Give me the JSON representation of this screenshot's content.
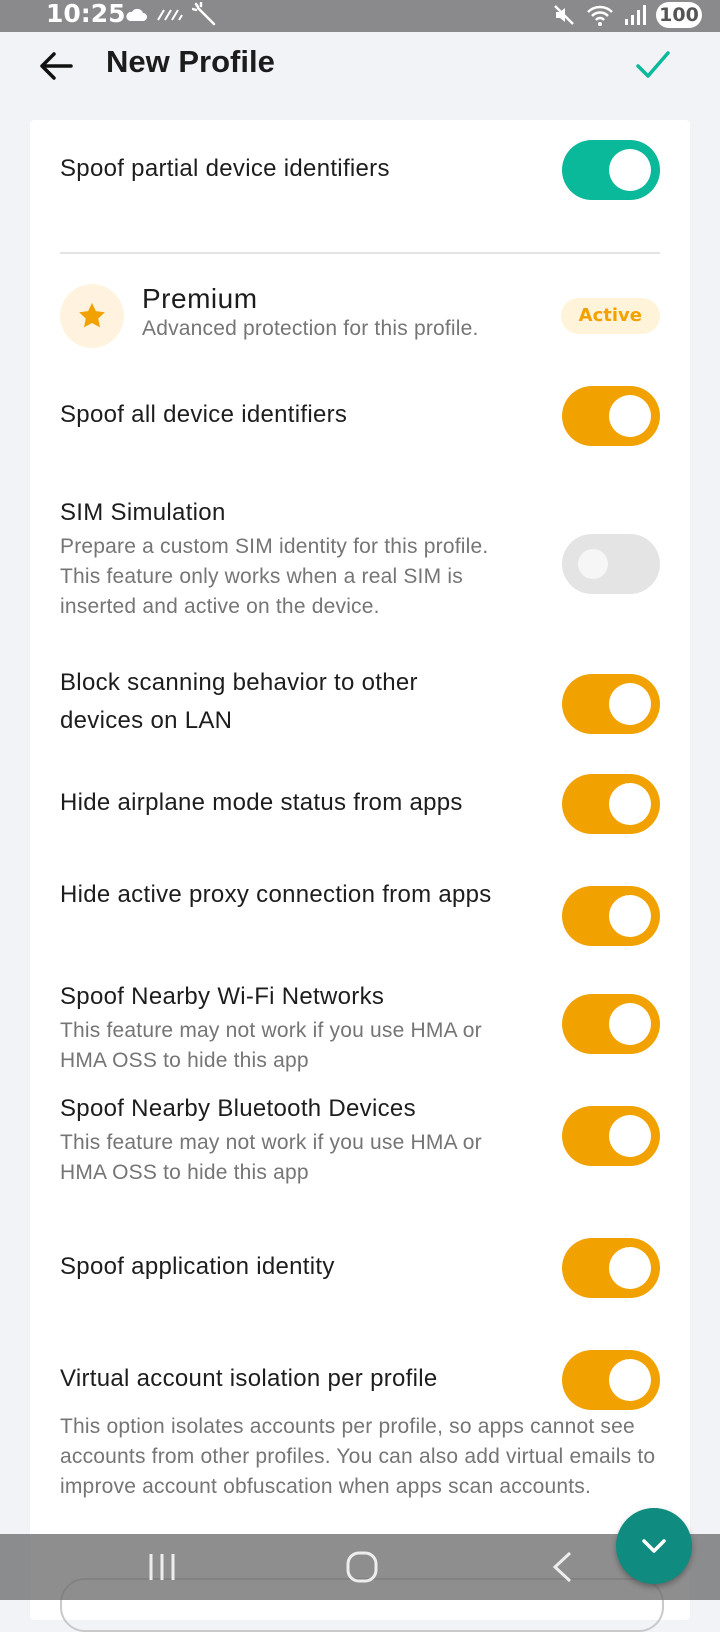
{
  "status_bar": {
    "time": "10:25",
    "battery": "100"
  },
  "appbar": {
    "title": "New Profile"
  },
  "partial": {
    "label": "Spoof partial device identifiers",
    "enabled": true
  },
  "premium": {
    "title": "Premium",
    "subtitle": "Advanced protection for this profile.",
    "badge": "Active"
  },
  "settings": [
    {
      "label": "Spoof all device identifiers",
      "enabled": true
    },
    {
      "label": "SIM Simulation",
      "description": "Prepare a custom SIM identity for this profile. This feature only works when a real SIM is inserted and active on the device.",
      "enabled": false
    },
    {
      "label": "Block scanning behavior to other devices on LAN",
      "enabled": true
    },
    {
      "label": "Hide airplane mode status from apps",
      "enabled": true
    },
    {
      "label": "Hide active proxy connection from apps",
      "enabled": true
    },
    {
      "label": "Spoof Nearby Wi-Fi Networks",
      "description": "This feature may not work if you use HMA or HMA OSS to hide this app",
      "enabled": true
    },
    {
      "label": "Spoof Nearby Bluetooth Devices",
      "description": "This feature may not work if you use HMA or HMA OSS to hide this app",
      "enabled": true
    },
    {
      "label": "Spoof application identity",
      "enabled": true
    },
    {
      "label": "Virtual account isolation per profile",
      "enabled": true
    }
  ],
  "footnote": "This option isolates accounts per profile, so apps cannot see accounts from other profiles. You can also add virtual emails to improve account obfuscation when apps scan accounts.",
  "colors": {
    "teal": "#0ab89a",
    "orange": "#f2a200",
    "fab": "#0f8b7f"
  },
  "icons": {
    "back": "arrow-left-icon",
    "confirm": "check-icon",
    "premium": "star-icon",
    "fab": "chevron-down-icon"
  }
}
